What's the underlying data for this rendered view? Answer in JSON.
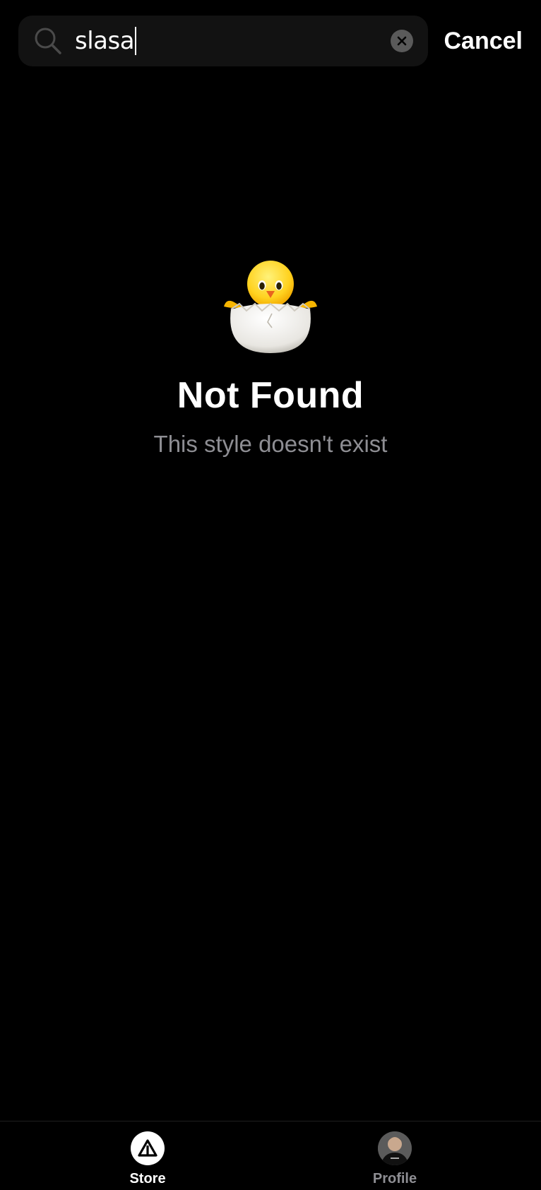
{
  "search": {
    "value": "slasa",
    "cancel_label": "Cancel"
  },
  "empty_state": {
    "title": "Not Found",
    "message": "This style doesn't exist",
    "illustration": "hatching-chick-icon"
  },
  "tab_bar": {
    "tabs": [
      {
        "label": "Store",
        "icon": "store-logo-icon",
        "active": true
      },
      {
        "label": "Profile",
        "icon": "avatar",
        "active": false
      }
    ]
  },
  "colors": {
    "background": "#000000",
    "search_field": "#121212",
    "secondary_text": "#8e8e93",
    "primary_text": "#ffffff"
  }
}
